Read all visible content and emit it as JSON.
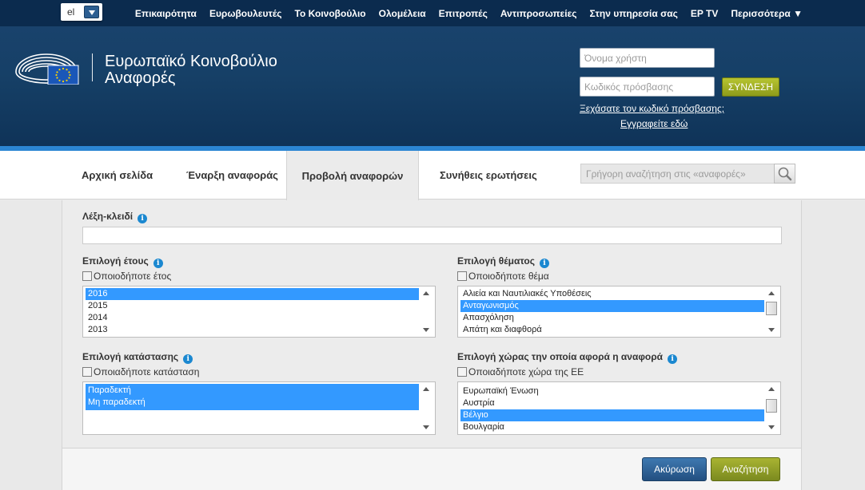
{
  "language": {
    "selected": "el"
  },
  "top_nav": [
    "Επικαιρότητα",
    "Ευρωβουλευτές",
    "Το Κοινοβούλιο",
    "Ολομέλεια",
    "Επιτροπές",
    "Αντιπροσωπείες",
    "Στην υπηρεσία σας",
    "EP TV",
    "Περισσότερα ▼"
  ],
  "brand": {
    "line1": "Ευρωπαϊκό Κοινοβούλιο",
    "line2": "Αναφορές"
  },
  "login": {
    "username_placeholder": "Όνομα χρήστη",
    "password_placeholder": "Κωδικός πρόσβασης",
    "login_button": "ΣΥΝΔΕΣΗ",
    "forgot_link": "Ξεχάσατε τον κωδικό πρόσβασης;",
    "register_link": "Εγγραφείτε εδώ"
  },
  "tabs": [
    {
      "label": "Αρχική σελίδα",
      "active": false
    },
    {
      "label": "Έναρξη αναφοράς",
      "active": false
    },
    {
      "label": "Προβολή αναφορών",
      "active": true
    },
    {
      "label": "Συνήθεις ερωτήσεις",
      "active": false
    }
  ],
  "quick_search": {
    "placeholder": "Γρήγορη αναζήτηση στις «αναφορές»",
    "value": ""
  },
  "form": {
    "keyword": {
      "label": "Λέξη-κλειδί",
      "value": ""
    },
    "year": {
      "label": "Επιλογή έτους",
      "any_label": "Οποιοδήποτε έτος",
      "any_checked": false,
      "options": [
        {
          "text": "2016",
          "selected": true
        },
        {
          "text": "2015",
          "selected": false
        },
        {
          "text": "2014",
          "selected": false
        },
        {
          "text": "2013",
          "selected": false
        }
      ]
    },
    "topic": {
      "label": "Επιλογή θέματος",
      "any_label": "Οποιοδήποτε θέμα",
      "any_checked": false,
      "options": [
        {
          "text": "Αλιεία και Ναυτιλιακές Υποθέσεις",
          "selected": false
        },
        {
          "text": "Ανταγωνισμός",
          "selected": true
        },
        {
          "text": "Απασχόληση",
          "selected": false
        },
        {
          "text": "Απάτη και διαφθορά",
          "selected": false
        }
      ]
    },
    "status": {
      "label": "Επιλογή κατάστασης",
      "any_label": "Οποιαδήποτε κατάσταση",
      "any_checked": false,
      "options": [
        {
          "text": "Παραδεκτή",
          "selected": true
        },
        {
          "text": "Μη παραδεκτή",
          "selected": true
        }
      ]
    },
    "country": {
      "label": "Επιλογή χώρας την οποία αφορά η αναφορά",
      "any_label": "Οποιαδήποτε χώρα της ΕΕ",
      "any_checked": false,
      "options": [
        {
          "text": "Ευρωπαϊκή Ένωση",
          "selected": false
        },
        {
          "text": "Αυστρία",
          "selected": false
        },
        {
          "text": "Βέλγιο",
          "selected": true
        },
        {
          "text": "Βουλγαρία",
          "selected": false
        }
      ]
    }
  },
  "buttons": {
    "cancel": "Ακύρωση",
    "search": "Αναζήτηση"
  },
  "colors": {
    "top_bar": "#0b2b4e",
    "header": "#164067",
    "accent_blue": "#2c86d3",
    "selection": "#3399ff",
    "login_green": "#9aa825",
    "cancel_blue": "#2f5f94"
  }
}
